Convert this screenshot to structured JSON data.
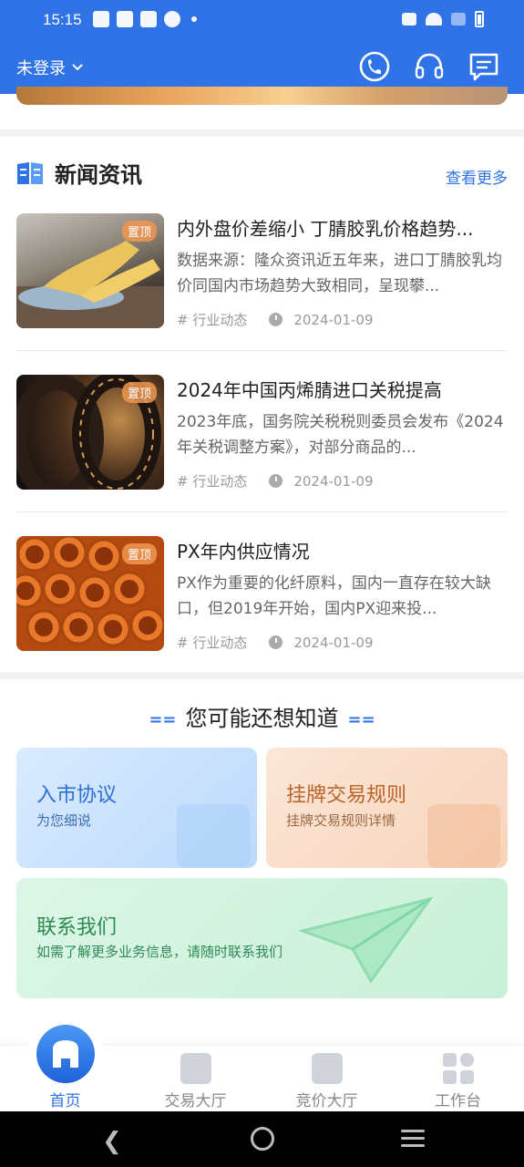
{
  "status_bar": {
    "time": "15:15"
  },
  "header": {
    "login_label": "未登录"
  },
  "news": {
    "title": "新闻资讯",
    "more": "查看更多",
    "items": [
      {
        "pin": "置顶",
        "title": "内外盘价差缩小 丁腈胶乳价格趋势...",
        "desc": "数据来源：隆众资讯近五年来，进口丁腈胶乳均价同国内市场趋势大致相同，呈现攀...",
        "tag": "# 行业动态",
        "date": "2024-01-09"
      },
      {
        "pin": "置顶",
        "title": "2024年中国丙烯腈进口关税提高",
        "desc": "2023年底，国务院关税税则委员会发布《2024年关税调整方案》，对部分商品的...",
        "tag": "# 行业动态",
        "date": "2024-01-09"
      },
      {
        "pin": "置顶",
        "title": "PX年内供应情况",
        "desc": "PX作为重要的化纤原料，国内一直存在较大缺口，但2019年开始，国内PX迎来投...",
        "tag": "# 行业动态",
        "date": "2024-01-09"
      }
    ]
  },
  "know": {
    "title": "您可能还想知道",
    "cards": [
      {
        "title": "入市协议",
        "sub": "为您细说"
      },
      {
        "title": "挂牌交易规则",
        "sub": "挂牌交易规则详情"
      },
      {
        "title": "联系我们",
        "sub": "如需了解更多业务信息，请随时联系我们"
      }
    ]
  },
  "bottom_nav": [
    "首页",
    "交易大厅",
    "竞价大厅",
    "工作台"
  ],
  "colors": {
    "accent": "#2f73e6"
  }
}
